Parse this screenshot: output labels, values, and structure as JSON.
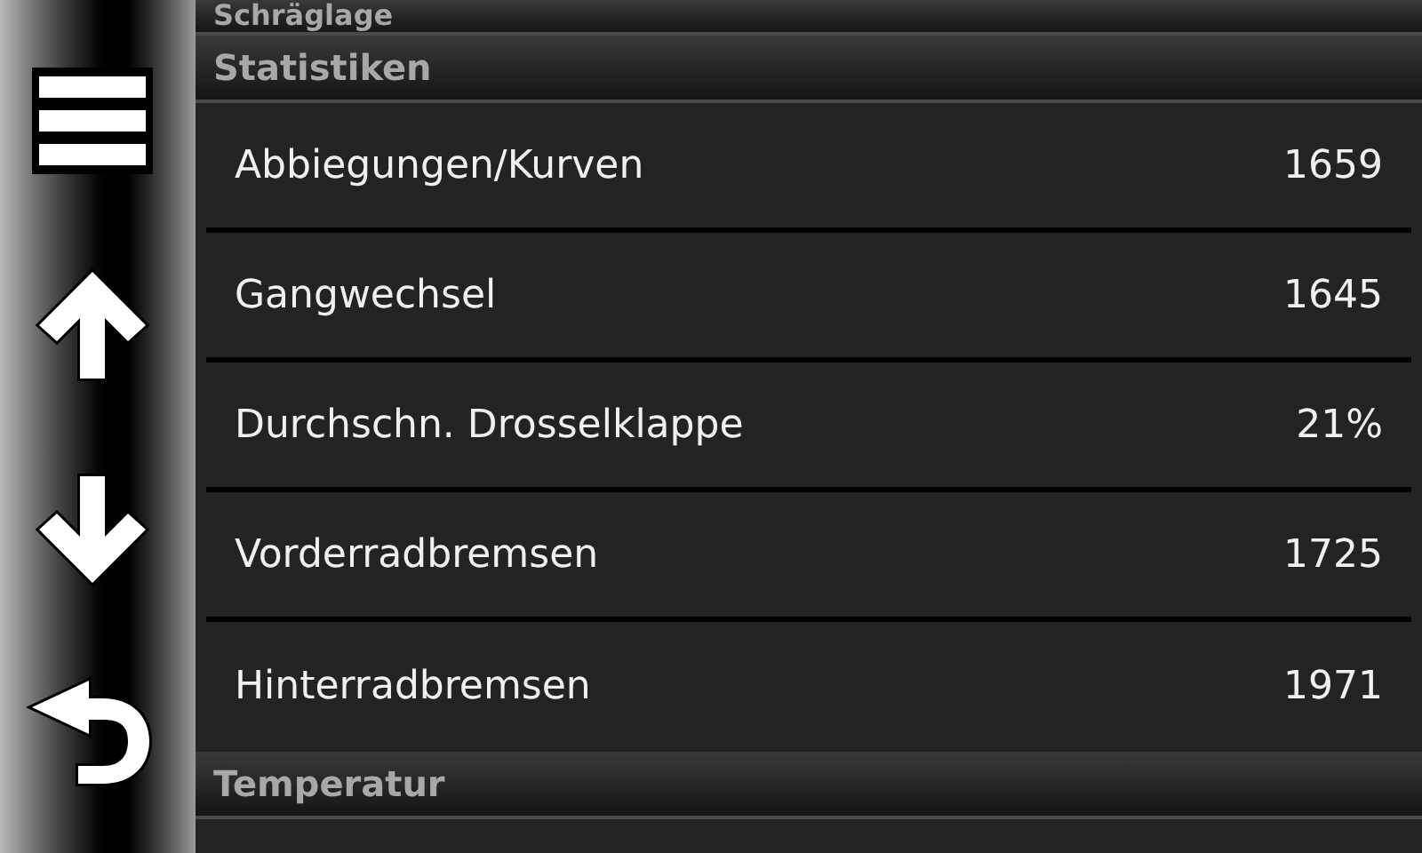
{
  "sidebar": {
    "buttons": [
      {
        "kind": "menu"
      },
      {
        "kind": "up"
      },
      {
        "kind": "down"
      },
      {
        "kind": "back"
      }
    ]
  },
  "sections": [
    {
      "title": "Schräglage"
    },
    {
      "title": "Statistiken",
      "rows": [
        {
          "label": "Abbiegungen/Kurven",
          "value": "1659"
        },
        {
          "label": "Gangwechsel",
          "value": "1645"
        },
        {
          "label": "Durchschn. Drosselklappe",
          "value": "21%"
        },
        {
          "label": "Vorderradbremsen",
          "value": "1725"
        },
        {
          "label": "Hinterradbremsen",
          "value": "1971"
        }
      ]
    },
    {
      "title": "Temperatur"
    }
  ]
}
